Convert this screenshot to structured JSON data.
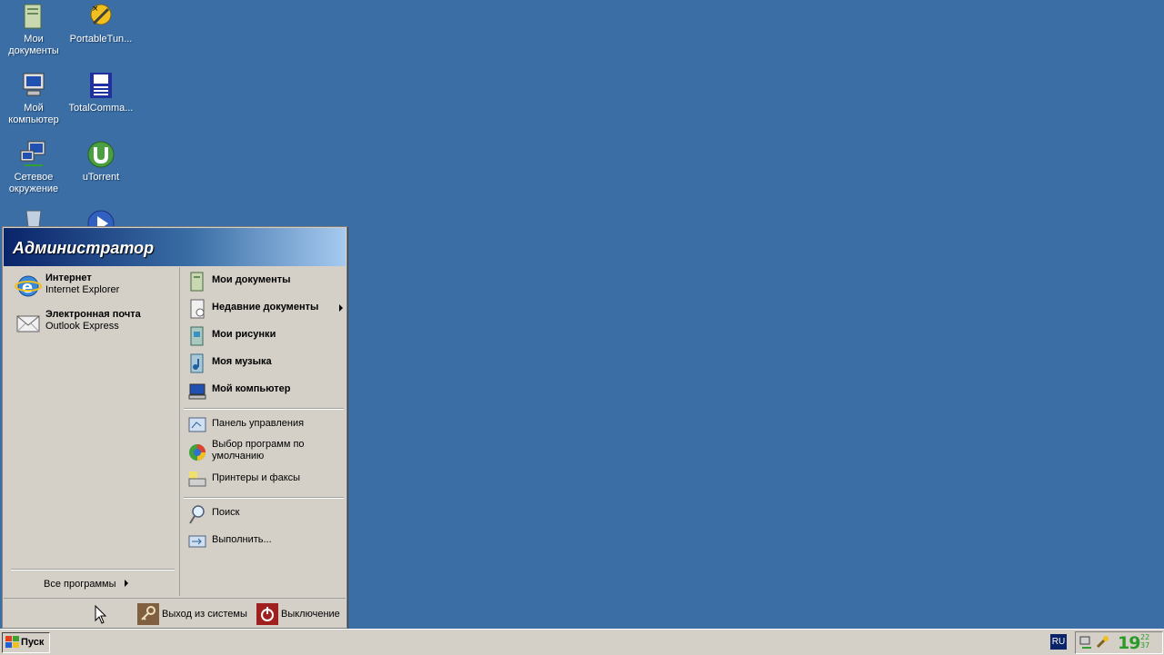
{
  "desktop": {
    "icons": [
      {
        "label_1": "Мои",
        "label_2": "документы",
        "icon": "my-documents-icon"
      },
      {
        "label_1": "PortableTun...",
        "icon": "portable-tuner-icon"
      },
      {
        "label_1": "Мой",
        "label_2": "компьютер",
        "icon": "my-computer-icon"
      },
      {
        "label_1": "TotalComma...",
        "icon": "total-commander-icon"
      },
      {
        "label_1": "Сетевое",
        "label_2": "окружение",
        "icon": "network-places-icon"
      },
      {
        "label_1": "uTorrent",
        "icon": "utorrent-icon"
      },
      {
        "icon": "recycle-bin-icon"
      },
      {
        "icon": "media-player-icon"
      }
    ]
  },
  "start_menu": {
    "user_name": "Администратор",
    "pinned": [
      {
        "title": "Интернет",
        "subtitle": "Internet Explorer",
        "icon": "internet-explorer-icon"
      },
      {
        "title": "Электронная почта",
        "subtitle": "Outlook Express",
        "icon": "outlook-express-icon"
      }
    ],
    "all_programs": "Все программы",
    "right_items": [
      {
        "label": "Мои документы",
        "icon": "my-documents-icon"
      },
      {
        "label": "Недавние документы",
        "icon": "recent-documents-icon"
      },
      {
        "label": "Мои рисунки",
        "icon": "my-pictures-icon"
      },
      {
        "label": "Моя музыка",
        "icon": "my-music-icon"
      },
      {
        "label": "Мой компьютер",
        "icon": "my-computer-icon"
      },
      {
        "label": "Панель управления",
        "icon": "control-panel-icon"
      },
      {
        "label_1": "Выбор программ по",
        "label_2": "умолчанию",
        "icon": "default-programs-icon"
      },
      {
        "label": "Принтеры и факсы",
        "icon": "printers-faxes-icon"
      },
      {
        "label": "Поиск",
        "icon": "search-icon"
      },
      {
        "label": "Выполнить...",
        "icon": "run-icon"
      }
    ],
    "logoff": "Выход из системы",
    "shutdown": "Выключение"
  },
  "taskbar": {
    "start_label": "Пуск",
    "language": "RU",
    "clock_big": "19",
    "clock_small_1": "22",
    "clock_small_2": "37"
  },
  "colors": {
    "desktop": "#3a6ea5",
    "menu_header_dark": "#0a246a",
    "menu_bg": "#d4d0c8",
    "clock": "#2a9a28"
  }
}
